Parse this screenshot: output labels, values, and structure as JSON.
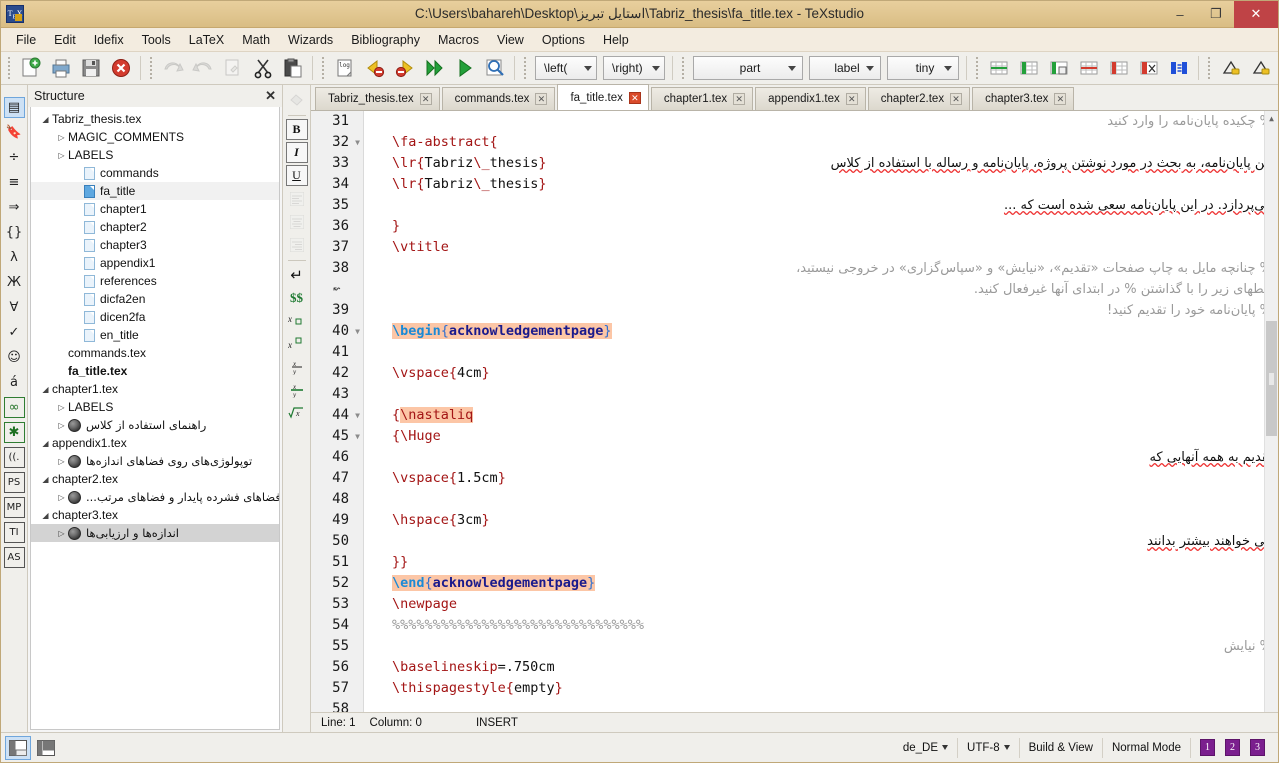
{
  "window": {
    "title": "C:\\Users\\bahareh\\Desktop\\استایل تبریز\\Tabriz_thesis\\fa_title.tex - TeXstudio",
    "minimize": "–",
    "maximize": "❐",
    "close": "✕"
  },
  "menubar": {
    "items": [
      "File",
      "Edit",
      "Idefix",
      "Tools",
      "LaTeX",
      "Math",
      "Wizards",
      "Bibliography",
      "Macros",
      "View",
      "Options",
      "Help"
    ]
  },
  "toolbar": {
    "combos": [
      {
        "name": "left-delimiter-combo",
        "value": "\\left("
      },
      {
        "name": "right-delimiter-combo",
        "value": "\\right)"
      },
      {
        "name": "sectioning-combo",
        "value": "part"
      },
      {
        "name": "label-combo",
        "value": "label"
      },
      {
        "name": "fontsize-combo",
        "value": "tiny"
      }
    ]
  },
  "rail": {
    "items": [
      {
        "name": "structure-view-icon",
        "glyph": "▤"
      },
      {
        "name": "bookmarks-icon",
        "glyph": "🔖"
      },
      {
        "name": "symbols-relation-icon",
        "glyph": "÷"
      },
      {
        "name": "symbols-arrows-icon",
        "glyph": "≡"
      },
      {
        "name": "symbols-implies-icon",
        "glyph": "⇒"
      },
      {
        "name": "symbols-delimiters-icon",
        "glyph": "{}"
      },
      {
        "name": "symbols-greek-icon",
        "glyph": "λ"
      },
      {
        "name": "symbols-cyrillic-icon",
        "glyph": "Ж"
      },
      {
        "name": "symbols-forall-icon",
        "glyph": "∀"
      },
      {
        "name": "symbols-misc-icon",
        "glyph": "✓"
      },
      {
        "name": "symbols-smiley-icon",
        "glyph": "☺"
      },
      {
        "name": "symbols-accent-icon",
        "glyph": "á"
      },
      {
        "name": "symbols-infty-icon",
        "glyph": "∞"
      },
      {
        "name": "symbols-asterisk-icon",
        "glyph": "✱"
      },
      {
        "name": "symbols-brackets-icon",
        "glyph": "((."
      },
      {
        "name": "postscript-icon",
        "glyph": "PS"
      },
      {
        "name": "metapost-icon",
        "glyph": "MP"
      },
      {
        "name": "tikz-icon",
        "glyph": "TI"
      },
      {
        "name": "asymptote-icon",
        "glyph": "AS"
      }
    ]
  },
  "structure": {
    "title": "Structure",
    "close_label": "✕",
    "tree": [
      {
        "indent": 0,
        "arrow": "▾",
        "icon": "none",
        "label": "Tabriz_thesis.tex",
        "state": "normal"
      },
      {
        "indent": 1,
        "arrow": "▸",
        "icon": "none",
        "label": "MAGIC_COMMENTS",
        "state": "normal"
      },
      {
        "indent": 1,
        "arrow": "▸",
        "icon": "none",
        "label": "LABELS",
        "state": "normal"
      },
      {
        "indent": 2,
        "arrow": "",
        "icon": "page",
        "label": "commands",
        "state": "normal"
      },
      {
        "indent": 2,
        "arrow": "",
        "icon": "page-blue",
        "label": "fa_title",
        "state": "highlight"
      },
      {
        "indent": 2,
        "arrow": "",
        "icon": "page",
        "label": "chapter1",
        "state": "normal"
      },
      {
        "indent": 2,
        "arrow": "",
        "icon": "page",
        "label": "chapter2",
        "state": "normal"
      },
      {
        "indent": 2,
        "arrow": "",
        "icon": "page",
        "label": "chapter3",
        "state": "normal"
      },
      {
        "indent": 2,
        "arrow": "",
        "icon": "page",
        "label": "appendix1",
        "state": "normal"
      },
      {
        "indent": 2,
        "arrow": "",
        "icon": "page",
        "label": "references",
        "state": "normal"
      },
      {
        "indent": 2,
        "arrow": "",
        "icon": "page",
        "label": "dicfa2en",
        "state": "normal"
      },
      {
        "indent": 2,
        "arrow": "",
        "icon": "page",
        "label": "dicen2fa",
        "state": "normal"
      },
      {
        "indent": 2,
        "arrow": "",
        "icon": "page",
        "label": "en_title",
        "state": "normal"
      },
      {
        "indent": 1,
        "arrow": "",
        "icon": "none",
        "label": "commands.tex",
        "state": "normal"
      },
      {
        "indent": 1,
        "arrow": "",
        "icon": "none",
        "label": "fa_title.tex",
        "state": "bold"
      },
      {
        "indent": 0,
        "arrow": "▾",
        "icon": "none",
        "label": "chapter1.tex",
        "state": "normal"
      },
      {
        "indent": 1,
        "arrow": "▸",
        "icon": "none",
        "label": "LABELS",
        "state": "normal"
      },
      {
        "indent": 1,
        "arrow": "▸",
        "icon": "ball",
        "label": "راهنمای استفاده از کلاس",
        "state": "rtl"
      },
      {
        "indent": 0,
        "arrow": "▾",
        "icon": "none",
        "label": "appendix1.tex",
        "state": "normal"
      },
      {
        "indent": 1,
        "arrow": "▸",
        "icon": "ball",
        "label": "توپولوژی‌های روی فضاهای اندازه‌ها",
        "state": "rtl"
      },
      {
        "indent": 0,
        "arrow": "▾",
        "icon": "none",
        "label": "chapter2.tex",
        "state": "normal"
      },
      {
        "indent": 1,
        "arrow": "▸",
        "icon": "ball",
        "label": "فضاهای فشرده پایدار و فضاهای مرتب...",
        "state": "rtl"
      },
      {
        "indent": 0,
        "arrow": "▾",
        "icon": "none",
        "label": "chapter3.tex",
        "state": "normal"
      },
      {
        "indent": 1,
        "arrow": "▸",
        "icon": "ball",
        "label": "اندازه‌ها و ارزیابی‌ها",
        "state": "rtl-selected"
      }
    ]
  },
  "vtools": {
    "items": [
      {
        "name": "highlight-icon",
        "glyph": "◆",
        "style": "dis"
      },
      {
        "name": "bold-button",
        "glyph": "B",
        "style": "bord"
      },
      {
        "name": "italic-button",
        "glyph": "I",
        "style": "bord italic"
      },
      {
        "name": "underline-button",
        "glyph": "U",
        "style": "bord underline"
      },
      {
        "name": "align-left-button",
        "glyph": "▤",
        "style": "dis"
      },
      {
        "name": "align-center-button",
        "glyph": "▤",
        "style": "dis"
      },
      {
        "name": "align-right-button",
        "glyph": "▤",
        "style": "dis"
      },
      {
        "name": "newline-button",
        "glyph": "↵",
        "style": ""
      },
      {
        "name": "math-mode-button",
        "glyph": "$$",
        "style": "green"
      },
      {
        "name": "subscript-button",
        "glyph": "x□",
        "style": "sub"
      },
      {
        "name": "superscript-button",
        "glyph": "x□",
        "style": "sup"
      },
      {
        "name": "fraction-button",
        "glyph": "x/y",
        "style": "frac"
      },
      {
        "name": "dfrac-button",
        "glyph": "x/y",
        "style": "frac2"
      },
      {
        "name": "sqrt-button",
        "glyph": "√x",
        "style": "sqrt"
      }
    ]
  },
  "tabs": {
    "items": [
      {
        "label": "Tabriz_thesis.tex",
        "active": false
      },
      {
        "label": "commands.tex",
        "active": false
      },
      {
        "label": "fa_title.tex",
        "active": true
      },
      {
        "label": "chapter1.tex",
        "active": false
      },
      {
        "label": "appendix1.tex",
        "active": false
      },
      {
        "label": "chapter2.tex",
        "active": false
      },
      {
        "label": "chapter3.tex",
        "active": false
      }
    ],
    "close_glyph": "✕"
  },
  "editor": {
    "first_line": 31,
    "lines": [
      {
        "n": "31",
        "fold": "",
        "code": ""
      },
      {
        "n": "32",
        "fold": "▾",
        "code": "\\fa-abstract{"
      },
      {
        "n": "33",
        "fold": "",
        "code": "\\lr{Tabriz\\_thesis}"
      },
      {
        "n": "34",
        "fold": "",
        "code": "\\lr{Tabriz\\_thesis}"
      },
      {
        "n": "35",
        "fold": "",
        "code": ""
      },
      {
        "n": "36",
        "fold": "",
        "code": "}"
      },
      {
        "n": "37",
        "fold": "",
        "code": "\\vtitle"
      },
      {
        "n": "38",
        "fold": "",
        "code": ""
      },
      {
        "n": "",
        "fold": "",
        "code": ""
      },
      {
        "n": "39",
        "fold": "",
        "code": ""
      },
      {
        "n": "40",
        "fold": "▾",
        "code": "\\begin{acknowledgementpage}"
      },
      {
        "n": "41",
        "fold": "",
        "code": ""
      },
      {
        "n": "42",
        "fold": "",
        "code": "\\vspace{4cm}"
      },
      {
        "n": "43",
        "fold": "",
        "code": ""
      },
      {
        "n": "44",
        "fold": "▾",
        "code": "{\\nastaliq"
      },
      {
        "n": "45",
        "fold": "▾",
        "code": "{\\Huge"
      },
      {
        "n": "46",
        "fold": "",
        "code": ""
      },
      {
        "n": "47",
        "fold": "",
        "code": "\\vspace{1.5cm}"
      },
      {
        "n": "48",
        "fold": "",
        "code": ""
      },
      {
        "n": "49",
        "fold": "",
        "code": "\\hspace{3cm}"
      },
      {
        "n": "50",
        "fold": "",
        "code": ""
      },
      {
        "n": "51",
        "fold": "",
        "code": "}}"
      },
      {
        "n": "52",
        "fold": "",
        "code": "\\end{acknowledgementpage}"
      },
      {
        "n": "53",
        "fold": "",
        "code": "\\newpage"
      },
      {
        "n": "54",
        "fold": "",
        "code": "%%%%%%%%%%%%%%%%%%%%%%%%%%%%%%%"
      },
      {
        "n": "55",
        "fold": "",
        "code": ""
      },
      {
        "n": "56",
        "fold": "",
        "code": "\\baselineskip=.750cm"
      },
      {
        "n": "57",
        "fold": "",
        "code": "\\thispagestyle{empty}"
      },
      {
        "n": "58",
        "fold": "",
        "code": ""
      }
    ],
    "persian": {
      "l31": "% چکیده پایان‌نامه را وارد کنید",
      "l33": "این پایان‌نامه، به بحث در مورد نوشتن پروژه، پایان‌نامه و رساله با استفاده از کلاس",
      "l35": "می‌پردازد. در این پایان‌نامه سعی شده است که ...",
      "l38a": "% چنانچه مایل به چاپ صفحات «تقدیم»، «نیایش» و «سپاس‌گزاری» در خروجی نیستید،",
      "l38b": "خطهای زیر را با گذاشتن % در ابتدای آنها غیرفعال کنید.",
      "l39": "% پایان‌نامه خود را تقدیم کنید!",
      "l46": "تقدیم به همه آنهایی که",
      "l50": "می خواهند بیشتر بدانند",
      "l55": "% نیایش"
    },
    "status": {
      "line_label": "Line: 1",
      "column_label": "Column: 0",
      "mode": "INSERT"
    }
  },
  "statusbar": {
    "layout_left_icon": "layout-single",
    "layout_right_icon": "layout-split",
    "language": "de_DE",
    "encoding": "UTF-8",
    "build": "Build & View",
    "mode": "Normal Mode",
    "badges": [
      "1",
      "2",
      "3"
    ]
  }
}
